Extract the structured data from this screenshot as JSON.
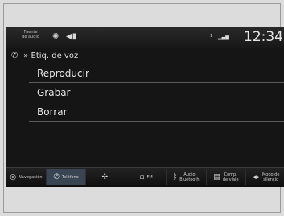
{
  "header": {
    "source_label": "Fuente\nde audio",
    "status_small": "1",
    "clock": "12:34"
  },
  "breadcrumb": {
    "icon": "phone-icon",
    "chevrons": "»",
    "title": "Etiq. de voz"
  },
  "menu": {
    "items": [
      {
        "label": "Reproducir"
      },
      {
        "label": "Grabar"
      },
      {
        "label": "Borrar"
      }
    ]
  },
  "bottom_nav": {
    "items": [
      {
        "icon": "navigation-icon",
        "label": "Navegación"
      },
      {
        "icon": "phone-icon",
        "label": "Teléfono",
        "active": true
      },
      {
        "icon": "radio-icon",
        "label": ""
      },
      {
        "icon": "fm-icon",
        "label": "FM"
      },
      {
        "icon": "bluetooth-icon",
        "label": "Audio\nBluetooth"
      },
      {
        "icon": "trip-icon",
        "label": "Comp.\nde viaje"
      },
      {
        "icon": "more-icon",
        "label": "Modo de\nsilencio"
      }
    ]
  }
}
